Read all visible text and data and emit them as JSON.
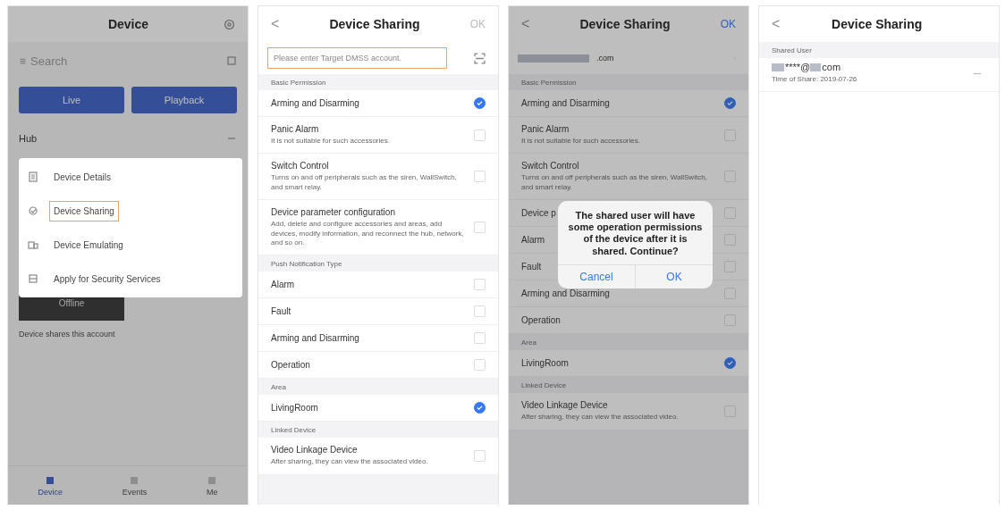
{
  "device_screen": {
    "title": "Device",
    "search": {
      "placeholder": "Search"
    },
    "actions": [
      "Live",
      "Playback"
    ],
    "group": "Hub",
    "tile": {
      "label": "Offline"
    },
    "note": "Device shares this account",
    "tabs": [
      {
        "label": "Device",
        "selected": true
      },
      {
        "label": "Events",
        "selected": false
      },
      {
        "label": "Me",
        "selected": false
      }
    ],
    "menu": [
      {
        "label": "Device Details",
        "highlighted": false
      },
      {
        "label": "Device Sharing",
        "highlighted": true
      },
      {
        "label": "Device Emulating",
        "highlighted": false
      },
      {
        "label": "Apply for Security Services",
        "highlighted": false
      }
    ]
  },
  "sharing_screens": [
    {
      "title": "Device Sharing",
      "back": "<",
      "confirm": "OK",
      "confirm_enabled": false,
      "account": {
        "placeholder": "Please enter Target DMSS account.",
        "highlighted": true
      },
      "sections": [
        {
          "header": "Basic Permission",
          "rows": [
            {
              "label": "Arming and Disarming",
              "checked": true
            }
          ]
        },
        {
          "rows": [
            {
              "label": "Panic Alarm",
              "description": "It is not suitable for such accessories.",
              "checked": false
            },
            {
              "label": "Switch Control",
              "description": "Turns on and off peripherals such as the siren, WallSwitch, and smart relay.",
              "checked": false
            },
            {
              "label": "Device parameter configuration",
              "description": "Add, delete and configure accessories and areas, add devices, modify information, and reconnect the hub, network, and so on.",
              "checked": false
            }
          ]
        },
        {
          "header": "Push Notification Type",
          "rows": [
            {
              "label": "Alarm",
              "checked": false
            },
            {
              "label": "Fault",
              "checked": false
            },
            {
              "label": "Arming and Disarming",
              "checked": false
            },
            {
              "label": "Operation",
              "checked": false
            }
          ]
        },
        {
          "header": "Area",
          "rows": [
            {
              "label": "LivingRoom",
              "checked": true
            }
          ]
        },
        {
          "header": "Linked Device",
          "rows": [
            {
              "label": "Video Linkage Device",
              "description": "After sharing, they can view the associated video.",
              "checked": false
            }
          ]
        }
      ]
    },
    {
      "title": "Device Sharing",
      "back": "<",
      "confirm": "OK",
      "confirm_enabled": true,
      "account": {
        "value": ".com",
        "masked": true,
        "highlighted": false
      },
      "sections": [
        {
          "header": "Basic Permission",
          "rows": [
            {
              "label": "Arming and Disarming",
              "checked": true
            }
          ]
        },
        {
          "rows": [
            {
              "label": "Panic Alarm",
              "description": "It is not suitable for such accessories.",
              "checked": false
            },
            {
              "label": "Switch Control",
              "description": "Turns on and off peripherals such as the siren, WallSwitch, and smart relay.",
              "checked": false
            },
            {
              "label": "Device p",
              "checked": false
            }
          ]
        },
        {
          "rows": [
            {
              "label": "Alarm",
              "checked": false
            },
            {
              "label": "Fault",
              "checked": false
            },
            {
              "label": "Arming and Disarming",
              "checked": false
            },
            {
              "label": "Operation",
              "checked": false
            }
          ]
        },
        {
          "header": "Area",
          "rows": [
            {
              "label": "LivingRoom",
              "checked": true
            }
          ]
        },
        {
          "header": "Linked Device",
          "rows": [
            {
              "label": "Video Linkage Device",
              "description": "After sharing, they can view the associated video.",
              "checked": false
            }
          ]
        }
      ],
      "dialog": {
        "message": "The shared user will have some operation permissions of the device after it is shared. Continue?",
        "buttons": [
          "Cancel",
          "OK"
        ]
      }
    }
  ],
  "shared_list_screen": {
    "title": "Device Sharing",
    "back": "<",
    "header": "Shared User",
    "users": [
      {
        "account": "****@",
        "suffix": "com",
        "time": "Time of Share: 2019-07-26",
        "menu": "—"
      }
    ]
  }
}
